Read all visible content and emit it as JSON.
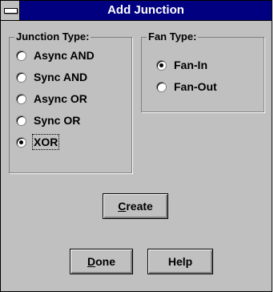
{
  "window": {
    "title": "Add Junction"
  },
  "junction_type": {
    "title": "Junction Type:",
    "options": [
      {
        "label": "Async AND",
        "checked": false
      },
      {
        "label": "Sync AND",
        "checked": false
      },
      {
        "label": "Async OR",
        "checked": false
      },
      {
        "label": "Sync OR",
        "checked": false
      },
      {
        "label": "XOR",
        "checked": true
      }
    ]
  },
  "fan_type": {
    "title": "Fan Type:",
    "options": [
      {
        "label": "Fan-In",
        "checked": true
      },
      {
        "label": "Fan-Out",
        "checked": false
      }
    ]
  },
  "buttons": {
    "create_mnemonic": "C",
    "create_rest": "reate",
    "done_mnemonic": "D",
    "done_rest": "one",
    "help_label": "Help"
  }
}
